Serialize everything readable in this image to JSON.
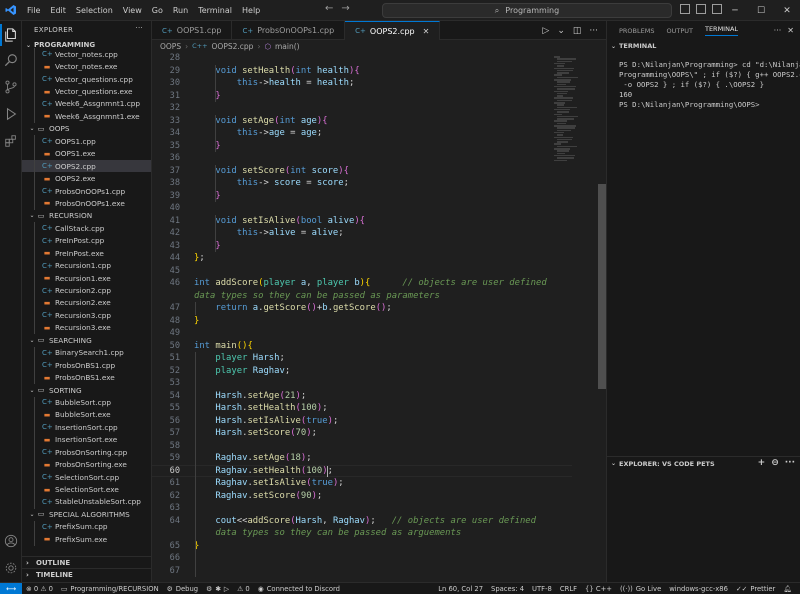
{
  "window": {
    "menu": [
      "File",
      "Edit",
      "Selection",
      "View",
      "Go",
      "Run",
      "Terminal",
      "Help"
    ],
    "search_text": "Programming"
  },
  "sidebar": {
    "title": "EXPLORER",
    "root": "PROGRAMMING",
    "items": [
      {
        "label": "Vector_notes.cpp",
        "kind": "cpp",
        "depth": 2
      },
      {
        "label": "Vector_notes.exe",
        "kind": "exe",
        "depth": 2
      },
      {
        "label": "Vector_questions.cpp",
        "kind": "cpp",
        "depth": 2
      },
      {
        "label": "Vector_questions.exe",
        "kind": "exe",
        "depth": 2
      },
      {
        "label": "Week6_Assgnmnt1.cpp",
        "kind": "cpp",
        "depth": 2
      },
      {
        "label": "Week6_Assgnmnt1.exe",
        "kind": "exe",
        "depth": 2
      },
      {
        "label": "OOPS",
        "kind": "dir",
        "depth": 1
      },
      {
        "label": "OOPS1.cpp",
        "kind": "cpp",
        "depth": 2
      },
      {
        "label": "OOPS1.exe",
        "kind": "exe",
        "depth": 2
      },
      {
        "label": "OOPS2.cpp",
        "kind": "cpp",
        "depth": 2,
        "selected": true
      },
      {
        "label": "OOPS2.exe",
        "kind": "exe",
        "depth": 2
      },
      {
        "label": "ProbsOnOOPs1.cpp",
        "kind": "cpp",
        "depth": 2
      },
      {
        "label": "ProbsOnOOPs1.exe",
        "kind": "exe",
        "depth": 2
      },
      {
        "label": "RECURSION",
        "kind": "dir",
        "depth": 1
      },
      {
        "label": "CallStack.cpp",
        "kind": "cpp",
        "depth": 2
      },
      {
        "label": "PreInPost.cpp",
        "kind": "cpp",
        "depth": 2
      },
      {
        "label": "PreInPost.exe",
        "kind": "exe",
        "depth": 2
      },
      {
        "label": "Recursion1.cpp",
        "kind": "cpp",
        "depth": 2
      },
      {
        "label": "Recursion1.exe",
        "kind": "exe",
        "depth": 2
      },
      {
        "label": "Recursion2.cpp",
        "kind": "cpp",
        "depth": 2
      },
      {
        "label": "Recursion2.exe",
        "kind": "exe",
        "depth": 2
      },
      {
        "label": "Recursion3.cpp",
        "kind": "cpp",
        "depth": 2
      },
      {
        "label": "Recursion3.exe",
        "kind": "exe",
        "depth": 2
      },
      {
        "label": "SEARCHING",
        "kind": "dir",
        "depth": 1
      },
      {
        "label": "BinarySearch1.cpp",
        "kind": "cpp",
        "depth": 2
      },
      {
        "label": "ProbsOnBS1.cpp",
        "kind": "cpp",
        "depth": 2
      },
      {
        "label": "ProbsOnBS1.exe",
        "kind": "exe",
        "depth": 2
      },
      {
        "label": "SORTING",
        "kind": "dir",
        "depth": 1
      },
      {
        "label": "BubbleSort.cpp",
        "kind": "cpp",
        "depth": 2
      },
      {
        "label": "BubbleSort.exe",
        "kind": "exe",
        "depth": 2
      },
      {
        "label": "InsertionSort.cpp",
        "kind": "cpp",
        "depth": 2
      },
      {
        "label": "InsertionSort.exe",
        "kind": "exe",
        "depth": 2
      },
      {
        "label": "ProbsOnSorting.cpp",
        "kind": "cpp",
        "depth": 2
      },
      {
        "label": "ProbsOnSorting.exe",
        "kind": "exe",
        "depth": 2
      },
      {
        "label": "SelectionSort.cpp",
        "kind": "cpp",
        "depth": 2
      },
      {
        "label": "SelectionSort.exe",
        "kind": "exe",
        "depth": 2
      },
      {
        "label": "StableUnstableSort.cpp",
        "kind": "cpp",
        "depth": 2
      },
      {
        "label": "SPECIAL ALGORITHMS",
        "kind": "dir",
        "depth": 1
      },
      {
        "label": "PrefixSum.cpp",
        "kind": "cpp",
        "depth": 2
      },
      {
        "label": "PrefixSum.exe",
        "kind": "exe",
        "depth": 2
      }
    ],
    "outline": "OUTLINE",
    "timeline": "TIMELINE"
  },
  "tabs": [
    {
      "label": "OOPS1.cpp",
      "active": false
    },
    {
      "label": "ProbsOnOOPs1.cpp",
      "active": false
    },
    {
      "label": "OOPS2.cpp",
      "active": true
    }
  ],
  "breadcrumb": [
    "OOPS",
    "OOPS2.cpp",
    "main()"
  ],
  "editor": {
    "current_line": "60",
    "lines": [
      {
        "n": "28",
        "html": ""
      },
      {
        "n": "29",
        "html": "    <span class='kw'>void</span> <span class='fn'>setHealth</span><span class='br2'>(</span><span class='kw'>int</span> <span class='var'>health</span><span class='br2'>)</span><span class='br2'>{</span>"
      },
      {
        "n": "30",
        "html": "        <span class='kw'>this</span>-&gt;<span class='var'>health</span> = <span class='var'>health</span>;"
      },
      {
        "n": "31",
        "html": "    <span class='br2'>}</span>"
      },
      {
        "n": "32",
        "html": ""
      },
      {
        "n": "33",
        "html": "    <span class='kw'>void</span> <span class='fn'>setAge</span><span class='br2'>(</span><span class='kw'>int</span> <span class='var'>age</span><span class='br2'>)</span><span class='br2'>{</span>"
      },
      {
        "n": "34",
        "html": "        <span class='kw'>this</span>-&gt;<span class='var'>age</span> = <span class='var'>age</span>;"
      },
      {
        "n": "35",
        "html": "    <span class='br2'>}</span>"
      },
      {
        "n": "36",
        "html": ""
      },
      {
        "n": "37",
        "html": "    <span class='kw'>void</span> <span class='fn'>setScore</span><span class='br2'>(</span><span class='kw'>int</span> <span class='var'>score</span><span class='br2'>)</span><span class='br2'>{</span>"
      },
      {
        "n": "38",
        "html": "        <span class='kw'>this</span>-&gt; <span class='var'>score</span> = <span class='var'>score</span>;"
      },
      {
        "n": "39",
        "html": "    <span class='br2'>}</span>"
      },
      {
        "n": "40",
        "html": ""
      },
      {
        "n": "41",
        "html": "    <span class='kw'>void</span> <span class='fn'>setIsAlive</span><span class='br2'>(</span><span class='kw'>bool</span> <span class='var'>alive</span><span class='br2'>)</span><span class='br2'>{</span>"
      },
      {
        "n": "42",
        "html": "        <span class='kw'>this</span>-&gt;<span class='var'>alive</span> = <span class='var'>alive</span>;"
      },
      {
        "n": "43",
        "html": "    <span class='br2'>}</span>"
      },
      {
        "n": "44",
        "html": "<span class='br'>}</span>;"
      },
      {
        "n": "45",
        "html": ""
      },
      {
        "n": "46",
        "html": "<span class='kw'>int</span> <span class='fn'>addScore</span><span class='br'>(</span><span class='ty'>player</span> <span class='var'>a</span>, <span class='ty'>player</span> <span class='var'>b</span><span class='br'>)</span><span class='br'>{</span>      <span class='cm'>// objects are user defined</span>"
      },
      {
        "n": "",
        "html": "<span class='cm'>data types so they can be passed as parameters</span>"
      },
      {
        "n": "47",
        "html": "    <span class='kw'>return</span> <span class='var'>a</span>.<span class='fn'>getScore</span><span class='br2'>()</span>+<span class='var'>b</span>.<span class='fn'>getScore</span><span class='br2'>()</span>;"
      },
      {
        "n": "48",
        "html": "<span class='br'>}</span>"
      },
      {
        "n": "49",
        "html": ""
      },
      {
        "n": "50",
        "html": "<span class='kw'>int</span> <span class='fn'>main</span><span class='br'>()</span><span class='br'>{</span>"
      },
      {
        "n": "51",
        "html": "    <span class='ty'>player</span> <span class='var'>Harsh</span>;"
      },
      {
        "n": "52",
        "html": "    <span class='ty'>player</span> <span class='var'>Raghav</span>;"
      },
      {
        "n": "53",
        "html": ""
      },
      {
        "n": "54",
        "html": "    <span class='var'>Harsh</span>.<span class='fn'>setAge</span><span class='br2'>(</span><span class='num'>21</span><span class='br2'>)</span>;"
      },
      {
        "n": "55",
        "html": "    <span class='var'>Harsh</span>.<span class='fn'>setHealth</span><span class='br2'>(</span><span class='num'>100</span><span class='br2'>)</span>;"
      },
      {
        "n": "56",
        "html": "    <span class='var'>Harsh</span>.<span class='fn'>setIsAlive</span><span class='br2'>(</span><span class='kw'>true</span><span class='br2'>)</span>;"
      },
      {
        "n": "57",
        "html": "    <span class='var'>Harsh</span>.<span class='fn'>setScore</span><span class='br2'>(</span><span class='num'>70</span><span class='br2'>)</span>;"
      },
      {
        "n": "58",
        "html": ""
      },
      {
        "n": "59",
        "html": "    <span class='var'>Raghav</span>.<span class='fn'>setAge</span><span class='br2'>(</span><span class='num'>18</span><span class='br2'>)</span>;"
      },
      {
        "n": "60",
        "html": "    <span class='var'>Raghav</span>.<span class='fn'>setHealth</span><span class='br2'>(</span><span class='num'>100</span><span class='br2'>)</span>;"
      },
      {
        "n": "61",
        "html": "    <span class='var'>Raghav</span>.<span class='fn'>setIsAlive</span><span class='br2'>(</span><span class='kw'>true</span><span class='br2'>)</span>;"
      },
      {
        "n": "62",
        "html": "    <span class='var'>Raghav</span>.<span class='fn'>setScore</span><span class='br2'>(</span><span class='num'>90</span><span class='br2'>)</span>;"
      },
      {
        "n": "63",
        "html": ""
      },
      {
        "n": "64",
        "html": "    <span class='var'>cout</span>&lt;&lt;<span class='fn'>addScore</span><span class='br2'>(</span><span class='var'>Harsh</span>, <span class='var'>Raghav</span><span class='br2'>)</span>;   <span class='cm'>// objects are user defined</span>"
      },
      {
        "n": "",
        "html": "    <span class='cm'>data types so they can be passed as arguements</span>"
      },
      {
        "n": "65",
        "html": "<span class='br'>}</span>"
      },
      {
        "n": "66",
        "html": ""
      },
      {
        "n": "67",
        "html": ""
      }
    ]
  },
  "panel": {
    "tabs": [
      "PROBLEMS",
      "OUTPUT",
      "TERMINAL"
    ],
    "active_tab": "TERMINAL",
    "terminal_title": "TERMINAL",
    "terminal_lines": [
      "PS D:\\Nilanjan\\Programming> cd \"d:\\Nilanjan\\",
      "Programming\\OOPS\\\" ; if ($?) { g++ OOPS2.cpp",
      " -o OOPS2 } ; if ($?) { .\\OOPS2 }",
      "160",
      "PS D:\\Nilanjan\\Programming\\OOPS>"
    ],
    "pets_title": "EXPLORER: VS CODE PETS"
  },
  "status": {
    "left": [
      "⊗ 0  ⚠ 0",
      "Programming/RECURSION",
      "Debug",
      "⚠ 0",
      "Connected to Discord"
    ],
    "right": [
      "Ln 60, Col 27",
      "Spaces: 4",
      "UTF-8",
      "CRLF",
      "{} C++",
      "Go Live",
      "windows-gcc-x86",
      "Prettier"
    ]
  },
  "colors": {
    "accent": "#0078d4",
    "editor_bg": "#1f1f1f",
    "sidebar_bg": "#181818"
  }
}
